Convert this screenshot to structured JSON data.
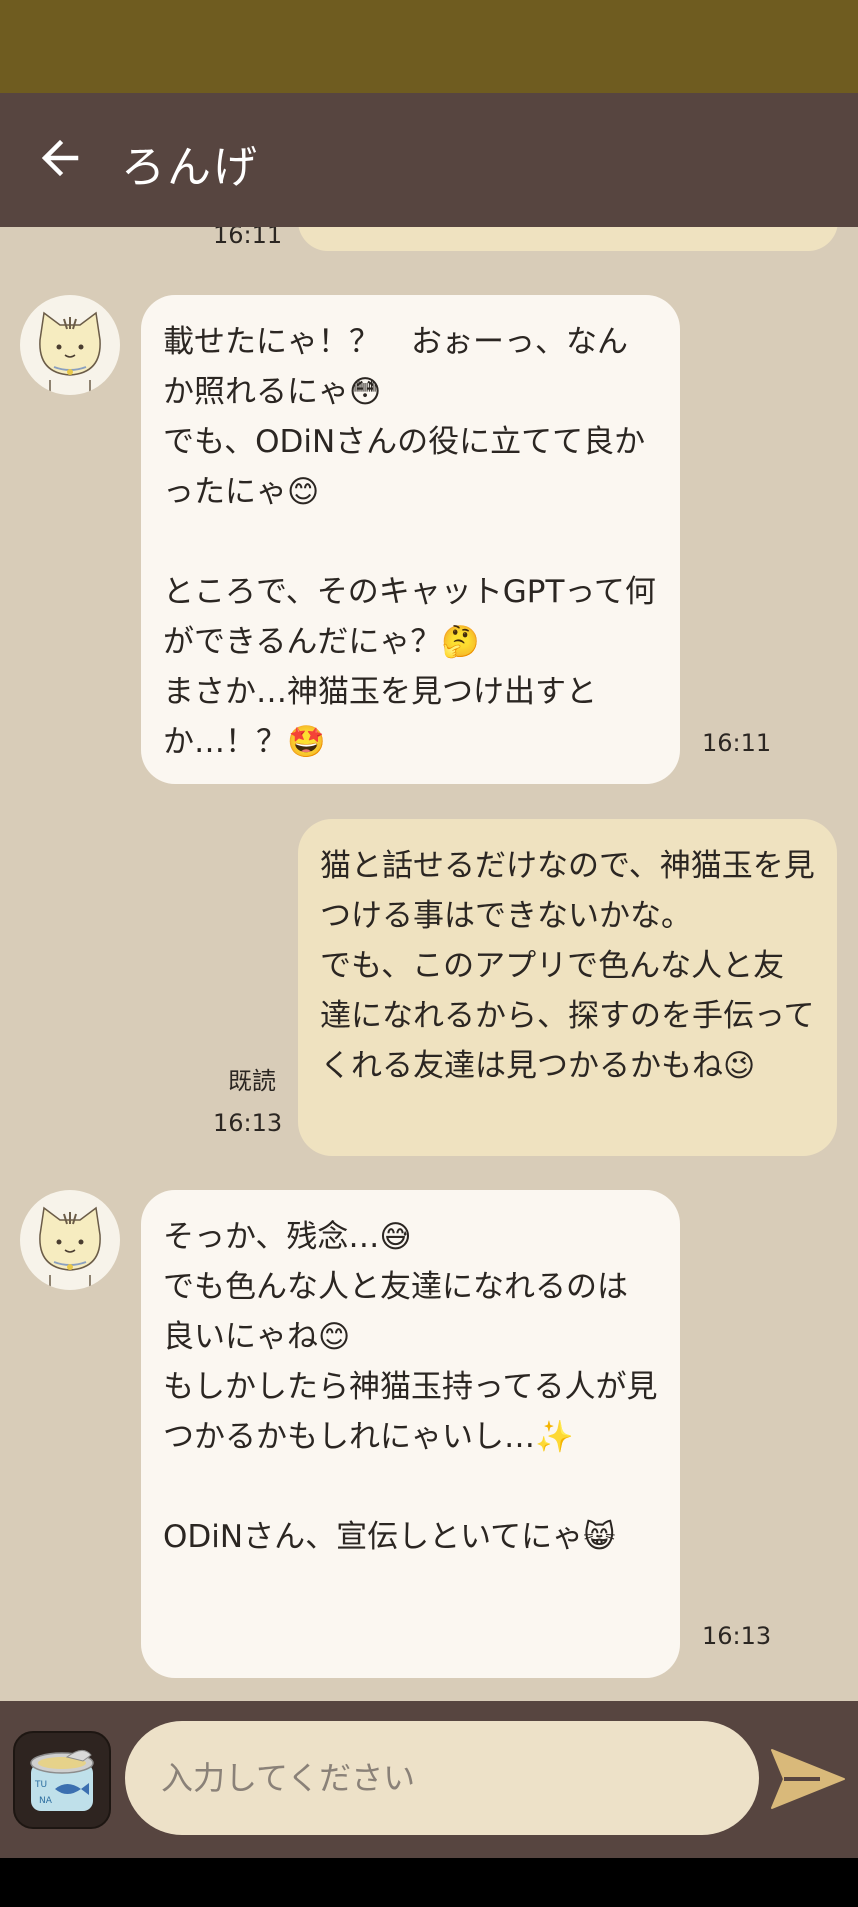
{
  "colors": {
    "statusbar": "#6f5c20",
    "appbar": "#574540",
    "chat_background": "#d8ccb8",
    "incoming_bubble": "#fbf7f1",
    "outgoing_bubble": "#efe2c0",
    "input_field": "#ede1c8",
    "send_icon": "#d9b97a"
  },
  "header": {
    "back_icon": "arrow-left-icon",
    "title": "ろんげ"
  },
  "chat": {
    "previous_time": "16:11",
    "messages": [
      {
        "direction": "incoming",
        "text": "載せたにゃ！？　おぉーっ、なんか照れるにゃ😳\nでも、ODiNさんの役に立てて良かったにゃ😊\n\nところで、そのキャットGPTって何ができるんだにゃ？🤔\nまさか…神猫玉を見つけ出すとか…！？🤩",
        "time": "16:11"
      },
      {
        "direction": "outgoing",
        "text": "猫と話せるだけなので、神猫玉を見つける事はできないかな。\nでも、このアプリで色んな人と友達になれるから、探すのを手伝ってくれる友達は見つかるかもね😉",
        "read": "既読",
        "time": "16:13"
      },
      {
        "direction": "incoming",
        "text": "そっか、残念…😅\nでも色んな人と友達になれるのは良いにゃね😊\nもしかしたら神猫玉持ってる人が見つかるかもしれにゃいし…✨\n\nODiNさん、宣伝しといてにゃ😸",
        "time": "16:13"
      }
    ]
  },
  "composer": {
    "stamp_icon": "tuna-can-icon",
    "placeholder": "入力してください",
    "send_icon": "send-arrow-icon"
  }
}
